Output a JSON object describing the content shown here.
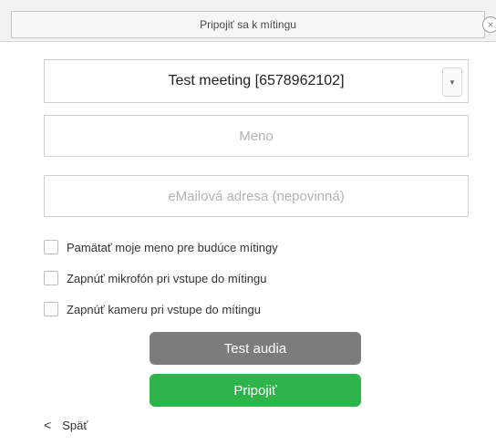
{
  "window": {
    "title": "Pripojiť sa k mítingu",
    "close_icon": "close-icon"
  },
  "meeting": {
    "selected": "Test meeting [6578962102]",
    "dropdown_icon": "▼"
  },
  "fields": {
    "name_placeholder": "Meno",
    "email_placeholder": "eMailová adresa (nepovinná)"
  },
  "options": [
    {
      "label": "Pamätať moje meno pre budúce mítingy",
      "checked": false
    },
    {
      "label": "Zapnúť mikrofón pri vstupe do mítingu",
      "checked": false
    },
    {
      "label": "Zapnúť kameru pri vstupe do mítingu",
      "checked": false
    }
  ],
  "buttons": {
    "test_audio": "Test audia",
    "join": "Pripojiť"
  },
  "back": {
    "label": "Späť",
    "icon": "<"
  },
  "colors": {
    "join": "#2db44b",
    "test_audio": "#7c7c7c"
  }
}
